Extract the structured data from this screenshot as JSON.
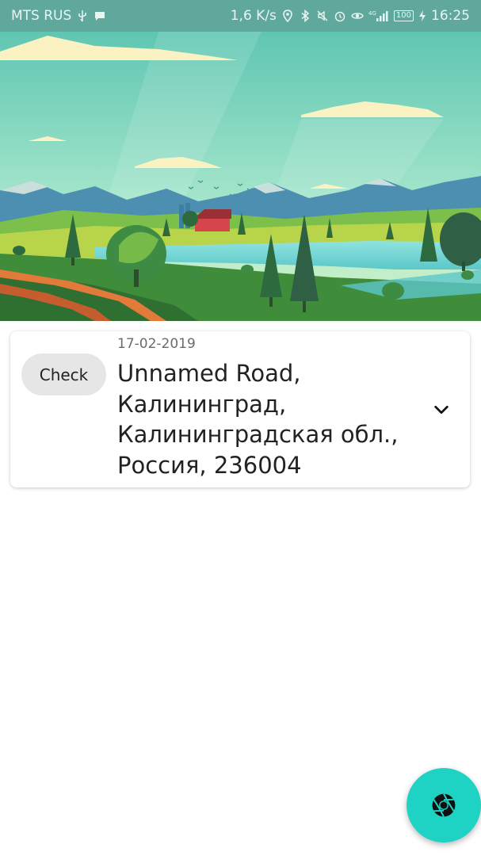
{
  "status_bar": {
    "carrier": "MTS RUS",
    "network_speed": "1,6 K/s",
    "network_type": "4G",
    "battery": "100",
    "time": "16:25",
    "icons": [
      "usb-icon",
      "message-icon",
      "location-icon",
      "bluetooth-icon",
      "mute-icon",
      "alarm-icon",
      "eye-icon",
      "signal-icon",
      "charging-icon"
    ]
  },
  "banner": {
    "icon": "landscape-illustration"
  },
  "entry": {
    "check_label": "Check",
    "date": "17-02-2019",
    "address": "Unnamed Road, Калининград, Калининградская обл., Россия, 236004",
    "expand_icon": "chevron-down-icon"
  },
  "fab": {
    "icon": "camera-shutter-icon",
    "color": "#1ed3c4"
  }
}
